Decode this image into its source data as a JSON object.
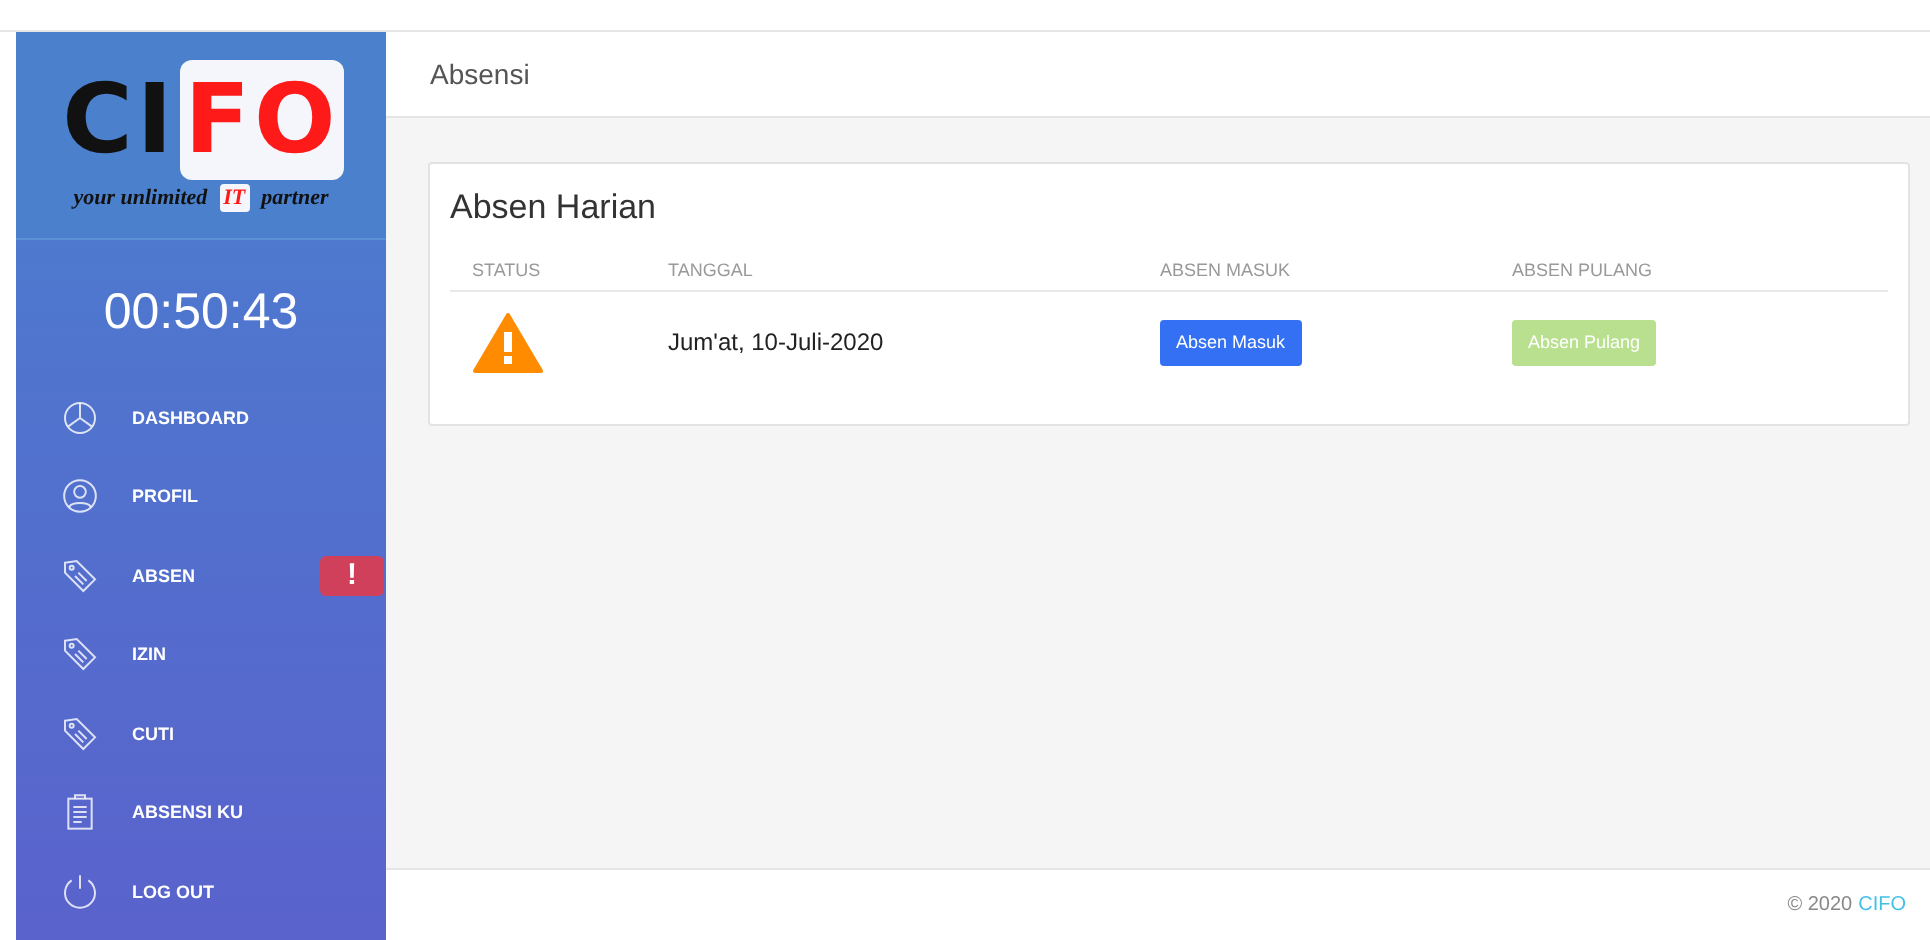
{
  "logo": {
    "parts": [
      {
        "text": "CI",
        "kind": "dark"
      },
      {
        "text": "FO",
        "kind": "accent"
      }
    ],
    "tagline": [
      {
        "text": "your unlimited",
        "kind": "dark"
      },
      {
        "text": "IT",
        "kind": "accent"
      },
      {
        "text": "partner",
        "kind": "dark"
      }
    ]
  },
  "clock": "00:50:43",
  "nav": [
    {
      "label": "DASHBOARD",
      "kind": "chart",
      "selected": false
    },
    {
      "label": "PROFIL",
      "kind": "user",
      "selected": false
    },
    {
      "label": "ABSEN",
      "kind": "tag",
      "selected": false,
      "badge": "!"
    },
    {
      "label": "IZIN",
      "kind": "tag",
      "selected": false
    },
    {
      "label": "CUTI",
      "kind": "tag",
      "selected": false
    },
    {
      "label": "ABSENSI KU",
      "kind": "clipboard",
      "selected": false
    },
    {
      "label": "LOG OUT",
      "kind": "power",
      "selected": false
    }
  ],
  "header": {
    "title": "Absensi"
  },
  "card": {
    "title": "Absen Harian",
    "columns": [
      "STATUS",
      "TANGGAL",
      "ABSEN MASUK",
      "ABSEN PULANG"
    ],
    "rows": [
      {
        "kind": "warning",
        "date": "Jum'at, 10-Juli-2020",
        "check_in": {
          "label": "Absen Masuk",
          "disabled": false
        },
        "check_out": {
          "label": "Absen Pulang",
          "disabled": true
        }
      }
    ]
  },
  "footer": {
    "text": "© 2020",
    "link": "CIFO"
  }
}
